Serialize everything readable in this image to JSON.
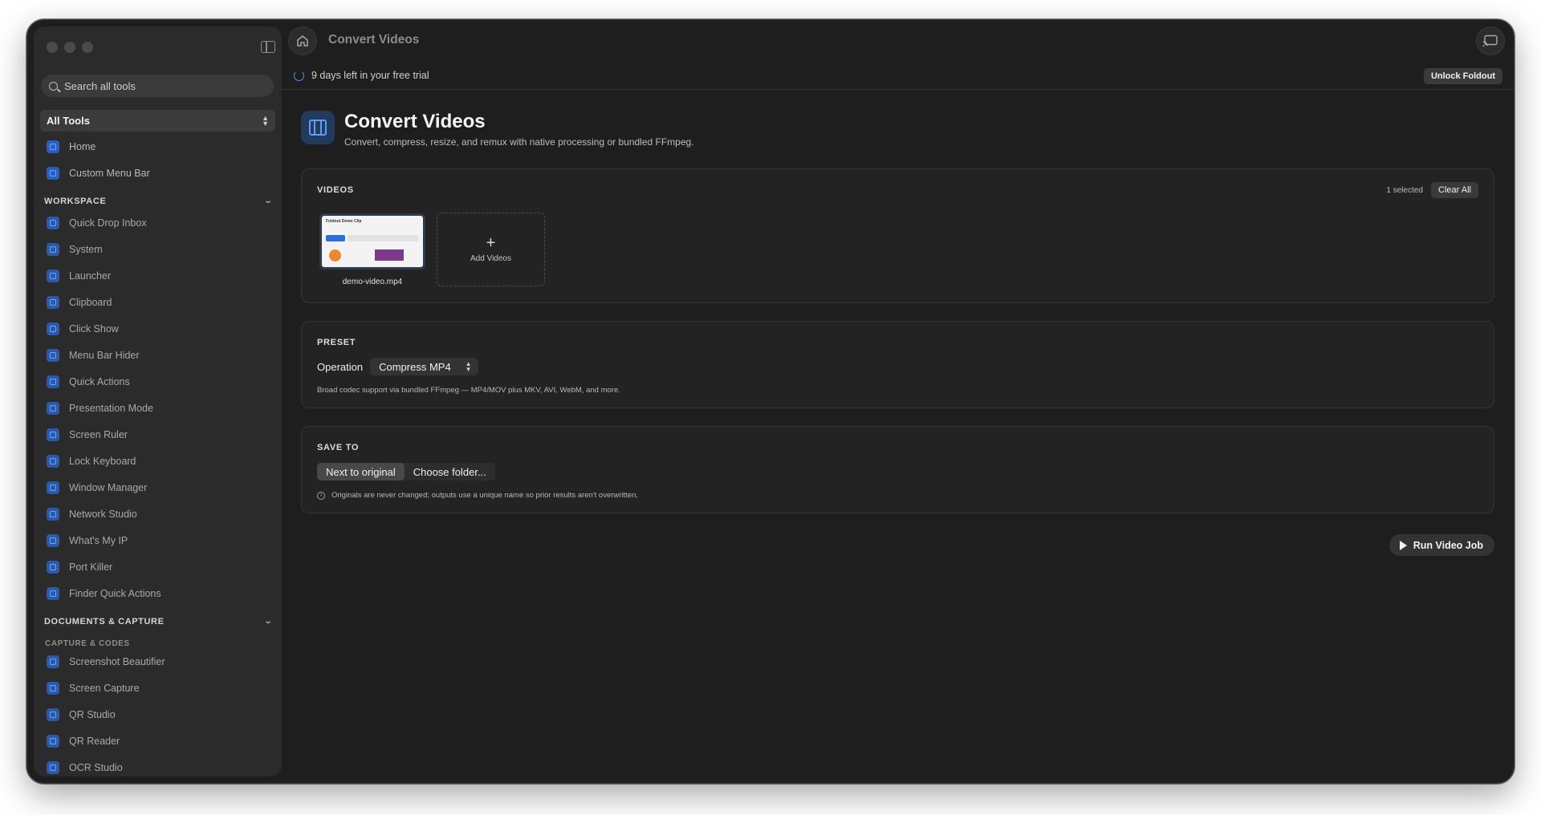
{
  "titlebar": {
    "title": "Convert Videos"
  },
  "search": {
    "placeholder": "Search all tools"
  },
  "sidebar": {
    "scope_select": "All Tools",
    "top_items": [
      {
        "label": "Home",
        "icon": "home-icon"
      },
      {
        "label": "Custom Menu Bar",
        "icon": "menubar-icon"
      }
    ],
    "workspace": {
      "heading": "WORKSPACE",
      "items": [
        {
          "label": "Quick Drop Inbox",
          "icon": "inbox-icon"
        },
        {
          "label": "System",
          "icon": "system-icon"
        },
        {
          "label": "Launcher",
          "icon": "command-icon"
        },
        {
          "label": "Clipboard",
          "icon": "clipboard-icon"
        },
        {
          "label": "Click Show",
          "icon": "cursor-click-icon"
        },
        {
          "label": "Menu Bar Hider",
          "icon": "menubar-hide-icon"
        },
        {
          "label": "Quick Actions",
          "icon": "sparkles-icon"
        },
        {
          "label": "Presentation Mode",
          "icon": "presentation-icon"
        },
        {
          "label": "Screen Ruler",
          "icon": "ruler-icon"
        },
        {
          "label": "Lock Keyboard",
          "icon": "lock-icon"
        },
        {
          "label": "Window Manager",
          "icon": "window-icon"
        },
        {
          "label": "Network Studio",
          "icon": "network-icon"
        },
        {
          "label": "What's My IP",
          "icon": "globe-icon"
        },
        {
          "label": "Port Killer",
          "icon": "port-icon"
        },
        {
          "label": "Finder Quick Actions",
          "icon": "gear-icon"
        }
      ]
    },
    "documents": {
      "heading": "DOCUMENTS & CAPTURE",
      "subheading": "CAPTURE & CODES",
      "items": [
        {
          "label": "Screenshot Beautifier",
          "icon": "screenshot-icon"
        },
        {
          "label": "Screen Capture",
          "icon": "capture-icon"
        },
        {
          "label": "QR Studio",
          "icon": "qr-icon"
        },
        {
          "label": "QR Reader",
          "icon": "qr-scan-icon"
        },
        {
          "label": "OCR Studio",
          "icon": "ocr-icon"
        }
      ]
    }
  },
  "trial": {
    "text": "9 days left in your free trial",
    "unlock_label": "Unlock Foldout"
  },
  "page": {
    "title": "Convert Videos",
    "subtitle": "Convert, compress, resize, and remux with native processing or bundled FFmpeg."
  },
  "videos": {
    "label": "VIDEOS",
    "selected_count": "1 selected",
    "clear_label": "Clear All",
    "items": [
      {
        "name": "demo-video.mp4",
        "thumb_title": "Foldout Demo Clip"
      }
    ],
    "add_label": "Add Videos"
  },
  "preset": {
    "label": "PRESET",
    "operation_label": "Operation",
    "operation_value": "Compress MP4",
    "hint": "Broad codec support via bundled FFmpeg — MP4/MOV plus MKV, AVI, WebM, and more."
  },
  "save_to": {
    "label": "SAVE TO",
    "options": [
      "Next to original",
      "Choose folder..."
    ],
    "selected": "Next to original",
    "note": "Originals are never changed; outputs use a unique name so prior results aren't overwritten."
  },
  "run": {
    "label": "Run Video Job"
  },
  "colors": {
    "accent": "#4a90ff",
    "background": "#1e1e1e",
    "sidebar": "#2b2b2b"
  }
}
